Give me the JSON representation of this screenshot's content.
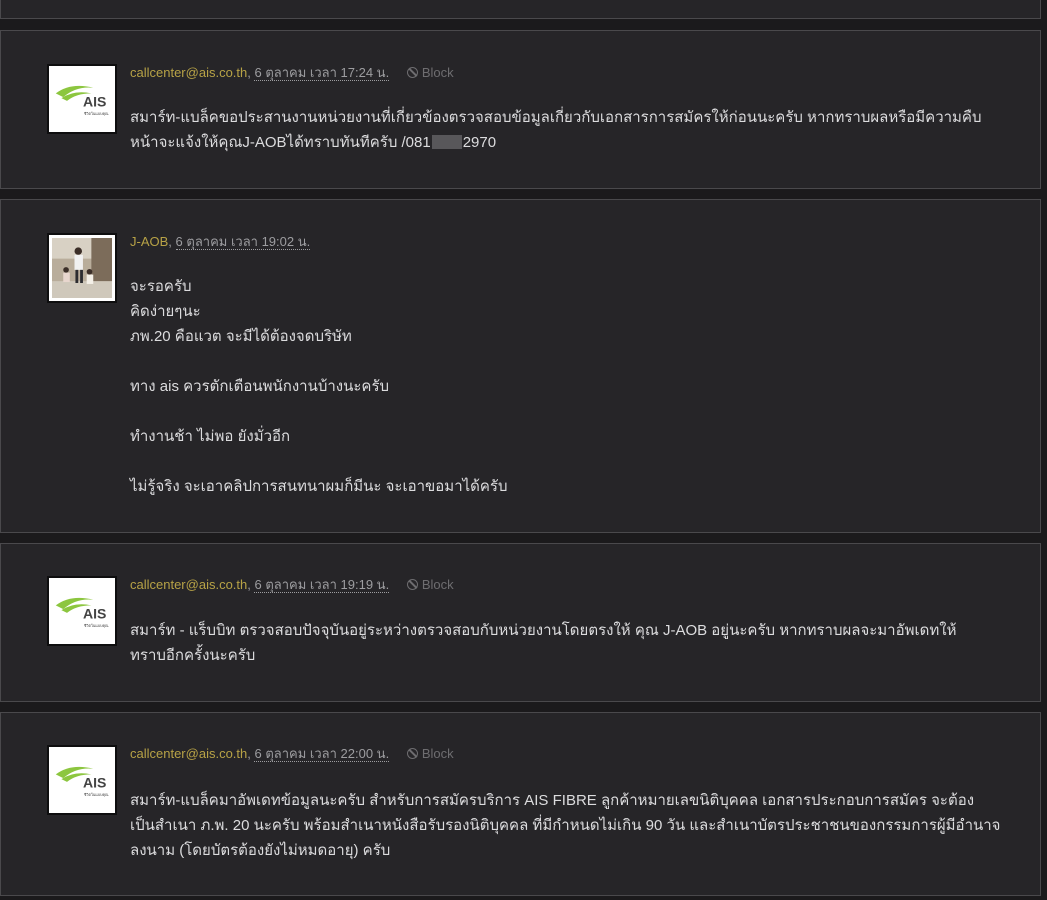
{
  "posts": [
    {
      "author": "callcenter@ais.co.th",
      "date": "6 ตุลาคม เวลา 17:24 น.",
      "block_label": "Block",
      "avatar": "ais-logo-icon",
      "lines": [
        "สมาร์ท-แบล็คขอประสานงานหน่วยงานที่เกี่ยวข้องตรวจสอบข้อมูลเกี่ยวกับเอกสารการสมัครให้ก่อนนะครับ หากทราบผลหรือมีความคืบ",
        "หน้าจะแจ้งให้คุณJ-AOBได้ทราบทันทีครับ /081",
        "2970"
      ]
    },
    {
      "author": "J-AOB",
      "date": "6 ตุลาคม เวลา 19:02 น.",
      "avatar": "user-photo-avatar",
      "lines": [
        "จะรอครับ",
        "คิดง่ายๆนะ",
        "ภพ.20 คือแวต จะมีได้ต้องจดบริษัท",
        "ทาง ais ควรตักเตือนพนักงานบ้างนะครับ",
        "ทำงานช้า ไม่พอ ยังมั่วอีก",
        "ไม่รู้จริง  จะเอาคลิปการสนทนาผมก็มีนะ จะเอาขอมาได้ครับ"
      ]
    },
    {
      "author": "callcenter@ais.co.th",
      "date": "6 ตุลาคม เวลา 19:19 น.",
      "block_label": "Block",
      "avatar": "ais-logo-icon",
      "lines": [
        "สมาร์ท - แร็บบิท ตรวจสอบปัจจุบันอยู่ระหว่างตรวจสอบกับหน่วยงานโดยตรงให้ คุณ J-AOB อยู่นะครับ หากทราบผลจะมาอัพเดทให้",
        "ทราบอีกครั้งนะครับ"
      ]
    },
    {
      "author": "callcenter@ais.co.th",
      "date": "6 ตุลาคม เวลา 22:00 น.",
      "block_label": "Block",
      "avatar": "ais-logo-icon",
      "lines": [
        "สมาร์ท-แบล็คมาอัพเดทข้อมูลนะครับ สำหรับการสมัครบริการ AIS FIBRE ลูกค้าหมายเลขนิติบุคคล เอกสารประกอบการสมัคร จะต้อง",
        "เป็นสำเนา ภ.พ. 20 นะครับ พร้อมสำเนาหนังสือรับรองนิติบุคคล ที่มีกำหนดไม่เกิน 90 วัน และสำเนาบัตรประชาชนของกรรมการผู้มีอำนาจ",
        "ลงนาม (โดยบัตรต้องยังไม่หมดอายุ) ครับ"
      ]
    }
  ],
  "logo": {
    "brand": "AIS",
    "tagline": "ชีวิตในแบบคุณ",
    "swoosh_color": "#8cc63f",
    "text_color": "#444444"
  }
}
